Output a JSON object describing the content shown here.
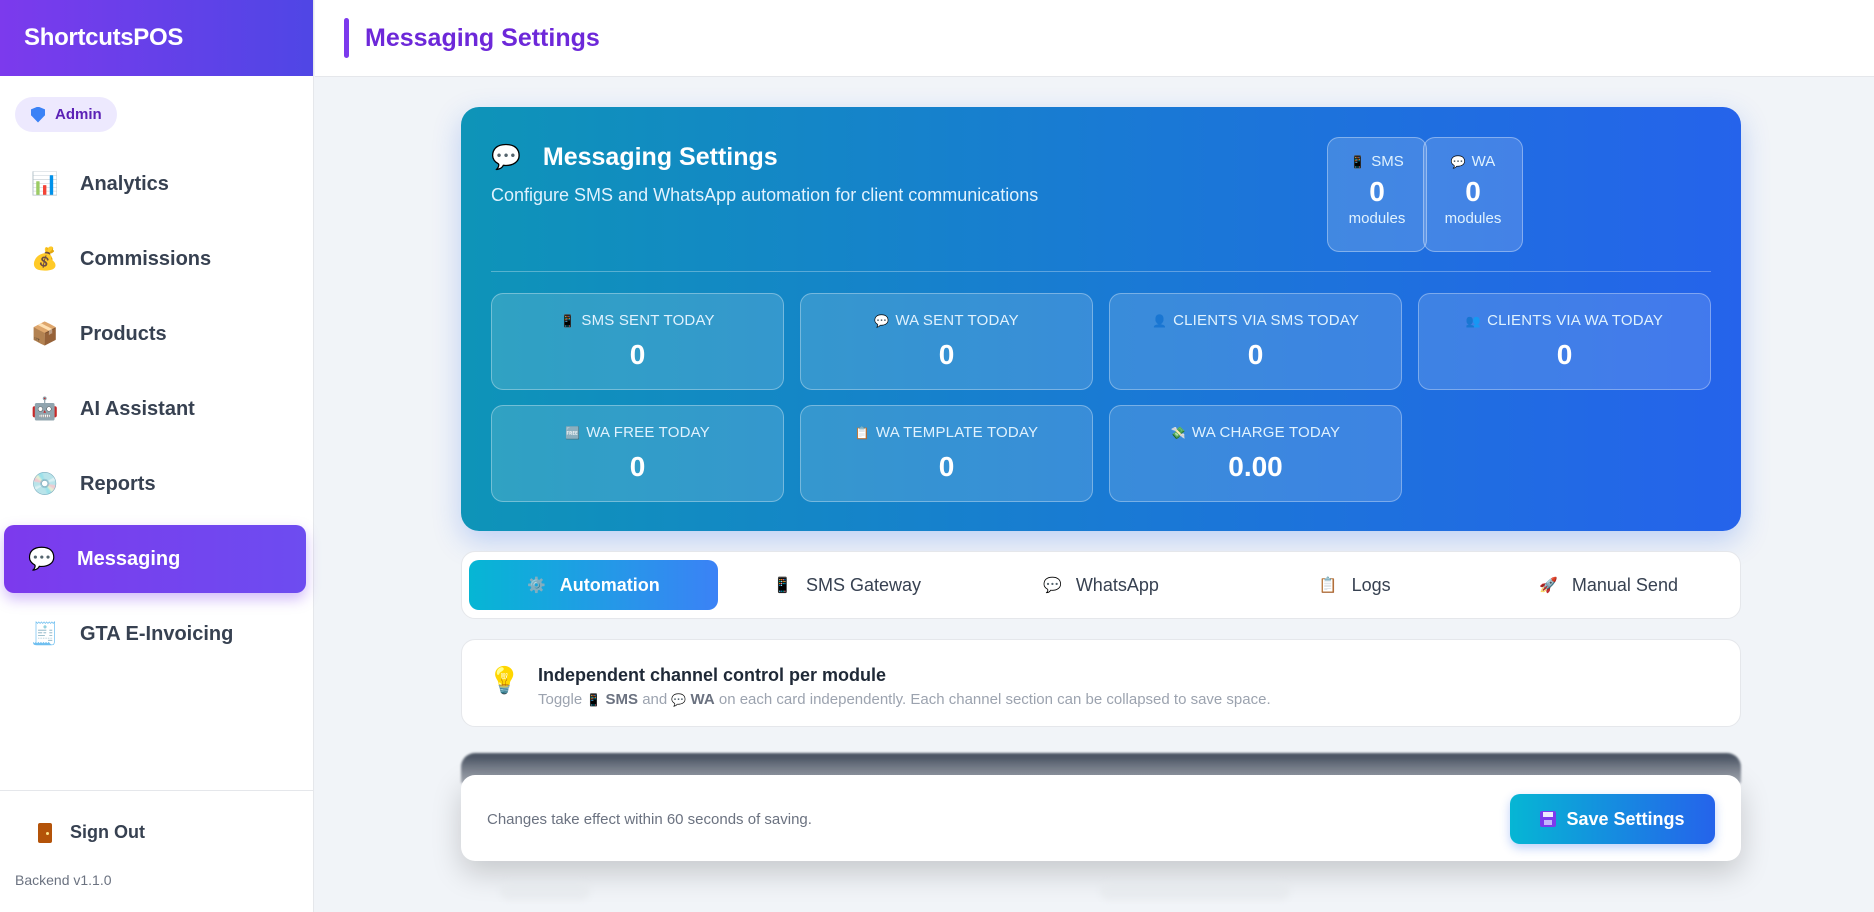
{
  "app": {
    "brand": "ShortcutsPOS",
    "version": "Backend v1.1.0"
  },
  "sidebar": {
    "role_badge": "Admin",
    "items": [
      {
        "label": "Analytics",
        "icon": "📊",
        "icon_name": "bar-chart-icon"
      },
      {
        "label": "Commissions",
        "icon": "💰",
        "icon_name": "money-bag-icon"
      },
      {
        "label": "Products",
        "icon": "📦",
        "icon_name": "package-icon"
      },
      {
        "label": "AI Assistant",
        "icon": "🤖",
        "icon_name": "robot-icon"
      },
      {
        "label": "Reports",
        "icon": "💿",
        "icon_name": "disc-icon"
      },
      {
        "label": "Messaging",
        "icon": "💬",
        "icon_name": "speech-bubble-icon",
        "active": true
      },
      {
        "label": "GTA E-Invoicing",
        "icon": "🧾",
        "icon_name": "receipt-icon"
      }
    ],
    "sign_out": "Sign Out"
  },
  "topbar": {
    "title": "Messaging Settings"
  },
  "hero": {
    "title": "Messaging Settings",
    "subtitle": "Configure SMS and WhatsApp automation for client communications",
    "modules": [
      {
        "label": "SMS",
        "icon": "📱",
        "value": "0",
        "unit": "modules"
      },
      {
        "label": "WA",
        "icon": "💬",
        "value": "0",
        "unit": "modules"
      }
    ],
    "stats": [
      {
        "label": "SMS SENT TODAY",
        "icon": "📱",
        "value": "0"
      },
      {
        "label": "WA SENT TODAY",
        "icon": "💬",
        "value": "0"
      },
      {
        "label": "CLIENTS VIA SMS TODAY",
        "icon": "👤",
        "value": "0"
      },
      {
        "label": "CLIENTS VIA WA TODAY",
        "icon": "👥",
        "value": "0"
      },
      {
        "label": "WA FREE TODAY",
        "icon": "🆓",
        "value": "0"
      },
      {
        "label": "WA TEMPLATE TODAY",
        "icon": "📋",
        "value": "0"
      },
      {
        "label": "WA CHARGE TODAY",
        "icon": "💸",
        "value": "0.00"
      }
    ]
  },
  "tabs": [
    {
      "label": "Automation",
      "icon": "⚙️",
      "active": true
    },
    {
      "label": "SMS Gateway",
      "icon": "📱"
    },
    {
      "label": "WhatsApp",
      "icon": "💬"
    },
    {
      "label": "Logs",
      "icon": "📋"
    },
    {
      "label": "Manual Send",
      "icon": "🚀"
    }
  ],
  "info": {
    "title": "Independent channel control per module",
    "desc_prefix": "Toggle",
    "sms": "SMS",
    "and": "and",
    "wa": "WA",
    "desc_suffix": "on each card independently. Each channel section can be collapsed to save space."
  },
  "savebar": {
    "note": "Changes take effect within 60 seconds of saving.",
    "button": "Save Settings"
  }
}
